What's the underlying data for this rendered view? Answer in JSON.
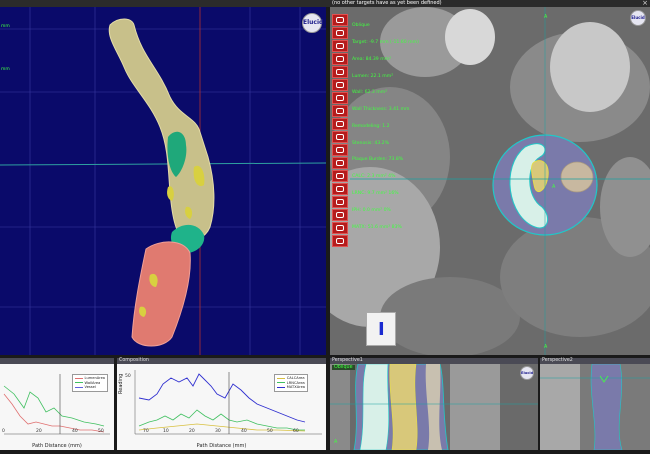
{
  "top_message": "(no other targets have as yet been defined)",
  "logo_text": "Elucid",
  "orientation_cube_label": "I",
  "tool_icons": [
    "target-icon",
    "cross-icon",
    "grid-icon",
    "vessel-icon",
    "view-icon",
    "lasso-icon",
    "toggle-icon",
    "color-icon",
    "tag-icon",
    "bookmark-icon",
    "bookmark-icon",
    "cube-icon",
    "shape-icon",
    "slice-icon",
    "target-icon",
    "disc-icon",
    "target-icon",
    "settings-icon"
  ],
  "info_lines": [
    "Oblique",
    "Target: -9.7 mm (-11.60 mm)",
    "Area: 84.39 mm²",
    "Lumen: 22.1 mm²",
    "Wall: 62.3 mm²",
    "Wall Thickness: 3.41 mm",
    "Remodeling: 1.2",
    "Stenosis: 43.2%",
    "Plaque Burden: 73.8%",
    "CALC: 2.3 mm² 4%",
    "LRNC: 9.7 mm² 16%",
    "IPH: 0.0 mm² 0%",
    "MATX: 51.6 mm² 83%"
  ],
  "side_texts": [
    "mm",
    "mm"
  ],
  "slice_markers": [
    "A",
    "A",
    "A"
  ],
  "panels": {
    "left_chart": {
      "title": "",
      "xlabel": "Path Distance (mm)",
      "legend": [
        "LumenArea",
        "WallArea",
        "Vessel"
      ],
      "ticks": [
        "0",
        "20",
        "40",
        "50"
      ]
    },
    "composition": {
      "title": "Composition",
      "xlabel": "Path Distance (mm)",
      "ylabel": "Reading",
      "legend": [
        "CALCArea",
        "LRNCArea",
        "MATXArea"
      ],
      "ticks": [
        "50",
        "70",
        "10",
        "20",
        "30",
        "40",
        "50",
        "60"
      ]
    },
    "perspective1": {
      "title": "Perspective1",
      "tag": "Oblique",
      "mark": "A"
    },
    "perspective2": {
      "title": "Perspective2"
    }
  },
  "colors": {
    "view3d_bg": "#0a0a6a",
    "lumen": "#d8f0e8",
    "lrnc": "#e8d88a",
    "matx": "#7a7aa8",
    "tool_red": "#b51c1c",
    "info_green": "#40ff40"
  }
}
